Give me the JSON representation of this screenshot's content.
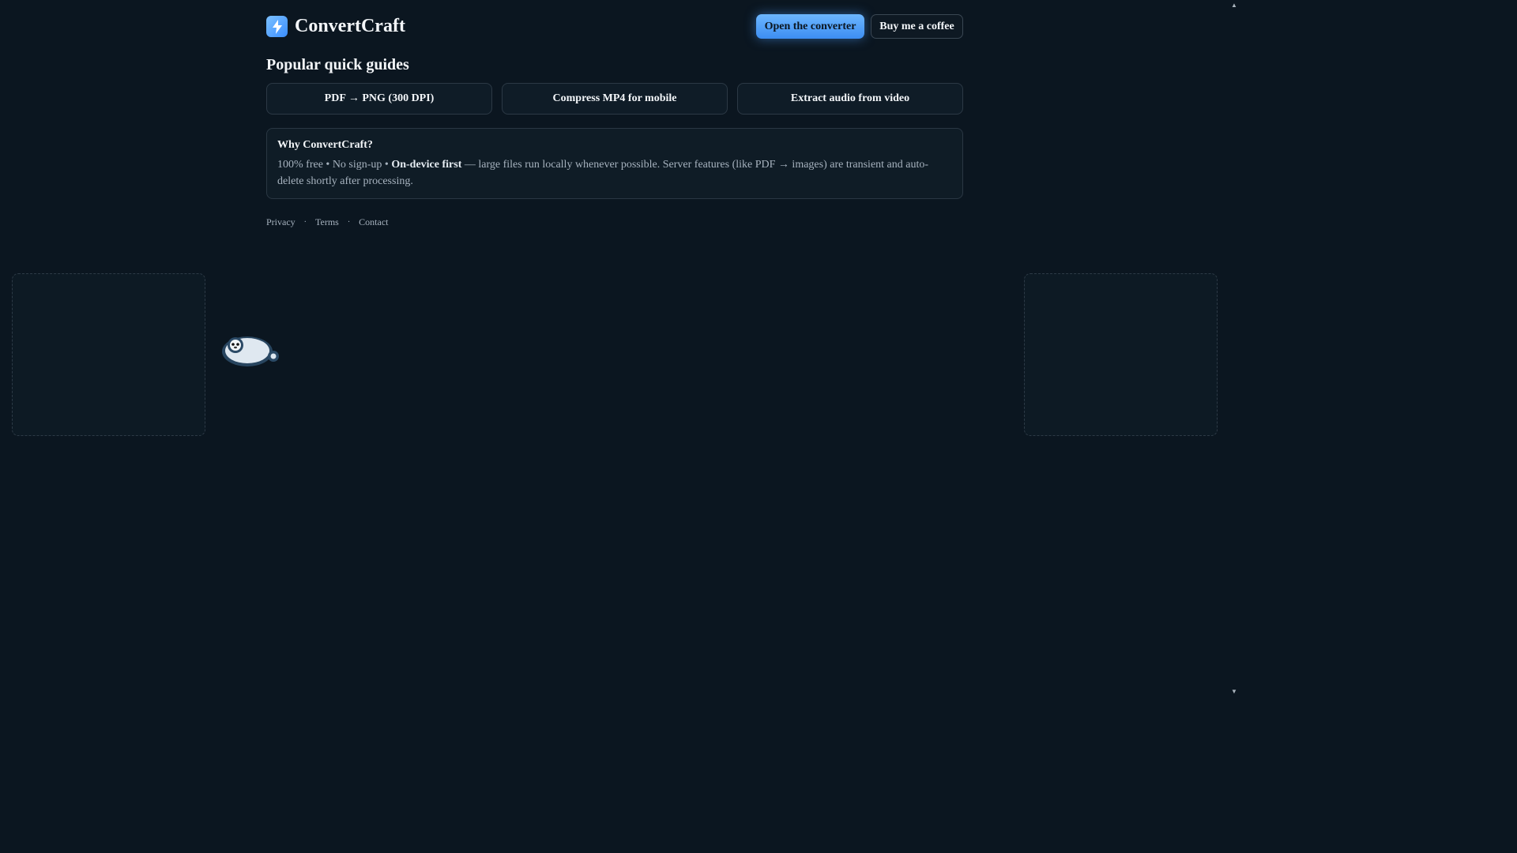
{
  "header": {
    "brand_name": "ConvertCraft",
    "open_converter_label": "Open the converter",
    "buy_coffee_label": "Buy me a coffee"
  },
  "guides": {
    "title": "Popular quick guides",
    "items": [
      {
        "label": "PDF → PNG (300 DPI)"
      },
      {
        "label": "Compress MP4 for mobile"
      },
      {
        "label": "Extract audio from video"
      }
    ]
  },
  "why": {
    "title": "Why ConvertCraft?",
    "text_intro": "100% free • No sign-up • ",
    "text_bold": "On-device first",
    "text_rest": " — large files run locally whenever possible. Server features (like PDF → images) are transient and auto-delete shortly after processing."
  },
  "footer": {
    "links": [
      "Privacy",
      "Terms",
      "Contact"
    ],
    "separator": "·"
  },
  "colors": {
    "background": "#0b1620",
    "accent": "#4a9cff",
    "card": "#0f1c27",
    "border": "#2c3945"
  },
  "icons": {
    "logo": "lightning-bolt-icon",
    "mascot": "panda-mascot-icon"
  }
}
